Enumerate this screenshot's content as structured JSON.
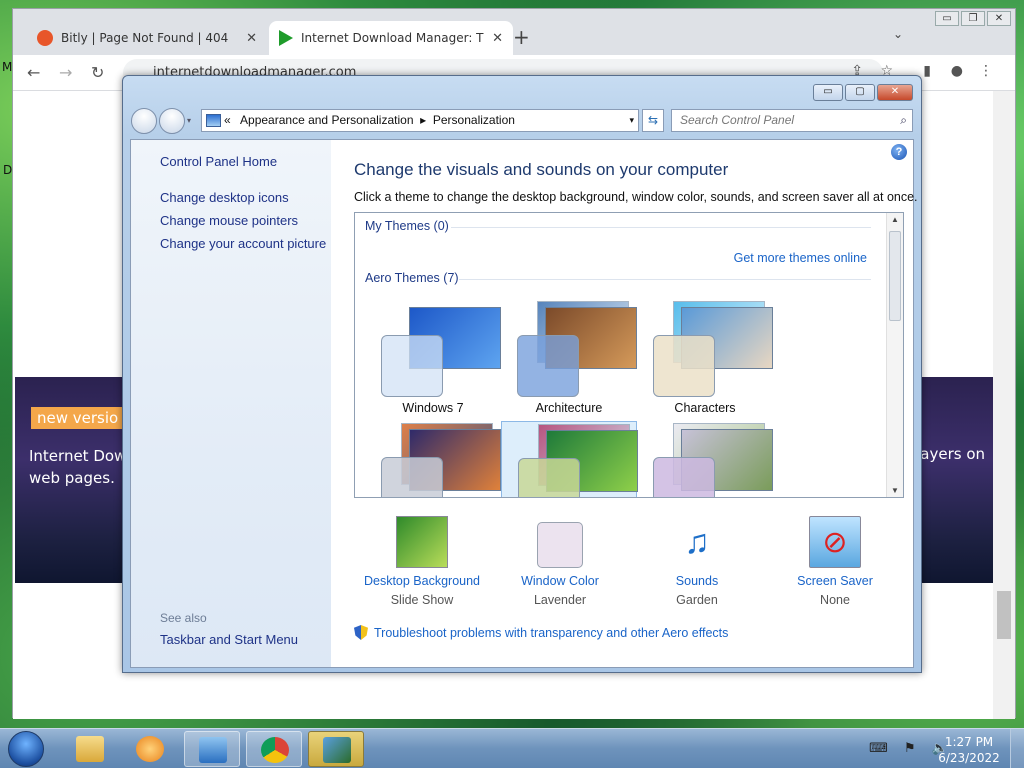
{
  "browser": {
    "tabs": [
      {
        "title": "Bitly | Page Not Found | 404",
        "close": "✕",
        "favicon_color": "#e8562a",
        "active": false
      },
      {
        "title": "Internet Download Manager: The",
        "close": "✕",
        "favicon_color": "#1f9c2b",
        "active": true
      }
    ],
    "new_tab": "+",
    "tab_list": "⌄",
    "url": "internetdownloadmanager.com",
    "back": "←",
    "forward": "→",
    "reload": "↻",
    "share_icon": "⇪",
    "bookmark_icon": "☆",
    "sidepanel_icon": "▮",
    "profile_icon": "●",
    "menu_icon": "⋮",
    "window_controls": [
      "▭",
      "❐",
      "✕"
    ],
    "page": {
      "badge": "new versio",
      "banner_text_left": "Internet Dow web pages.",
      "banner_text_right": "ayers on",
      "side_letter_m": "M",
      "side_letter_d": "D"
    }
  },
  "control_panel": {
    "window_controls": {
      "minimize": "▭",
      "maximize": "▢",
      "close": "✕"
    },
    "breadcrumb": {
      "prefix": "«",
      "parts": [
        "Appearance and Personalization",
        "Personalization"
      ],
      "separator": "▸",
      "dropdown": "▾"
    },
    "refresh": "⇆",
    "search": {
      "placeholder": "Search Control Panel",
      "icon": "⌕"
    },
    "left": {
      "home": "Control Panel Home",
      "links": [
        "Change desktop icons",
        "Change mouse pointers",
        "Change your account picture"
      ],
      "see_also_label": "See also",
      "see_also_links": [
        "Taskbar and Start Menu"
      ]
    },
    "help": "?",
    "title": "Change the visuals and sounds on your computer",
    "description": "Click a theme to change the desktop background, window color, sounds, and screen saver all at once.",
    "my_themes_label": "My Themes (0)",
    "get_more_link": "Get more themes online",
    "aero_themes_label": "Aero Themes (7)",
    "themes": [
      {
        "name": "Windows 7",
        "colors": [
          "#1d58c8",
          "#5ea4f0"
        ]
      },
      {
        "name": "Architecture",
        "colors": [
          "#7b4a2a",
          "#d59a5a"
        ]
      },
      {
        "name": "Characters",
        "colors": [
          "#5a9ad8",
          "#e8d7c2"
        ]
      },
      {
        "name": "",
        "colors": [
          "#2f2a6a",
          "#e0813a"
        ]
      },
      {
        "name": "",
        "colors": [
          "#1e7a3a",
          "#8fd04a"
        ]
      },
      {
        "name": "",
        "colors": [
          "#c7c2d8",
          "#7a9c5a"
        ]
      }
    ],
    "scroll": {
      "up": "▲",
      "down": "▼"
    },
    "bottom": [
      {
        "label": "Desktop Background",
        "value": "Slide Show",
        "icon": "desktop-background-icon"
      },
      {
        "label": "Window Color",
        "value": "Lavender",
        "icon": "window-color-icon"
      },
      {
        "label": "Sounds",
        "value": "Garden",
        "icon": "sounds-icon"
      },
      {
        "label": "Screen Saver",
        "value": "None",
        "icon": "screen-saver-icon"
      }
    ],
    "troubleshoot": "Troubleshoot problems with transparency and other Aero effects"
  },
  "taskbar": {
    "tray_icons": "⌨ ⚑ 🔈",
    "time": "1:27 PM",
    "date": "6/23/2022"
  }
}
